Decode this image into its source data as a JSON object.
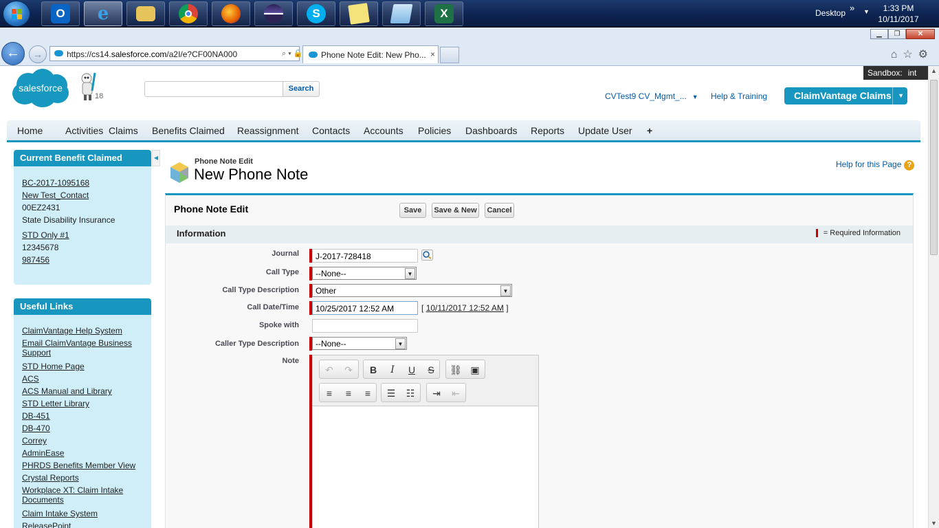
{
  "taskbar": {
    "apps": [
      "outlook",
      "internet-explorer",
      "file-explorer",
      "chrome",
      "firefox",
      "eclipse",
      "skype",
      "sticky-notes",
      "notepad",
      "excel"
    ],
    "desktop_label": "Desktop",
    "time": "1:33 PM",
    "date": "10/11/2017"
  },
  "browser": {
    "url_prefix": "https://cs14.",
    "url_domain": "salesforce.com",
    "url_rest": "/a2I/e?CF00NA000",
    "tab_title": "Phone Note Edit: New Pho...",
    "tab_close": "×"
  },
  "header": {
    "sandbox_label": "Sandbox:",
    "sandbox_value": "int",
    "logo_text": "salesforce",
    "mascot_count": "18",
    "search_placeholder": "",
    "search_button": "Search",
    "user_menu": "CVTest9 CV_Mgmt_...",
    "help_training": "Help & Training",
    "app_name": "ClaimVantage Claims"
  },
  "tabs": [
    "Home",
    "Activities",
    "Claims",
    "Benefits Claimed",
    "Reassignment",
    "Contacts",
    "Accounts",
    "Policies",
    "Dashboards",
    "Reports",
    "Update User",
    "+"
  ],
  "sidebar": {
    "benefit": {
      "title": "Current Benefit Claimed",
      "lines": [
        {
          "text": "BC-2017-1095168",
          "link": true
        },
        {
          "text": "New Test_Contact",
          "link": true
        },
        {
          "text": "00EZ2431",
          "link": false
        },
        {
          "text": "State Disability Insurance",
          "link": false
        },
        {
          "text": "STD Only #1",
          "link": true
        },
        {
          "text": "12345678",
          "link": false
        },
        {
          "text": "987456",
          "link": true
        }
      ]
    },
    "links": {
      "title": "Useful Links",
      "items": [
        "ClaimVantage Help System",
        "Email ClaimVantage Business Support",
        "STD Home Page",
        "ACS",
        "ACS Manual and Library",
        "STD Letter Library",
        "DB-451",
        "DB-470",
        "Correy",
        "AdminEase",
        "PHRDS Benefits Member View",
        "Crystal Reports",
        "Workplace XT: Claim Intake Documents",
        "Claim Intake System",
        "ReleasePoint"
      ]
    }
  },
  "page": {
    "subtitle": "Phone Note Edit",
    "title": "New Phone Note",
    "help_link": "Help for this Page",
    "help_icon": "?"
  },
  "form": {
    "title": "Phone Note Edit",
    "buttons": {
      "save": "Save",
      "save_new": "Save & New",
      "cancel": "Cancel"
    },
    "section": "Information",
    "required_legend": "= Required Information",
    "fields": {
      "journal": {
        "label": "Journal",
        "value": "J-2017-728418"
      },
      "call_type": {
        "label": "Call Type",
        "value": "--None--"
      },
      "call_type_desc": {
        "label": "Call Type Description",
        "value": "Other"
      },
      "call_datetime": {
        "label": "Call Date/Time",
        "value": "10/25/2017 12:52 AM",
        "now_link": "10/11/2017 12:52 AM",
        "bracket_open": "[",
        "bracket_close": "]"
      },
      "spoke_with": {
        "label": "Spoke with",
        "value": ""
      },
      "caller_type_desc": {
        "label": "Caller Type Description",
        "value": "--None--"
      },
      "note": {
        "label": "Note",
        "value": ""
      }
    }
  },
  "colors": {
    "brand": "#1797c0",
    "sidebar_body": "#cfeef8",
    "required": "#cc0000",
    "link": "#015ba7"
  }
}
